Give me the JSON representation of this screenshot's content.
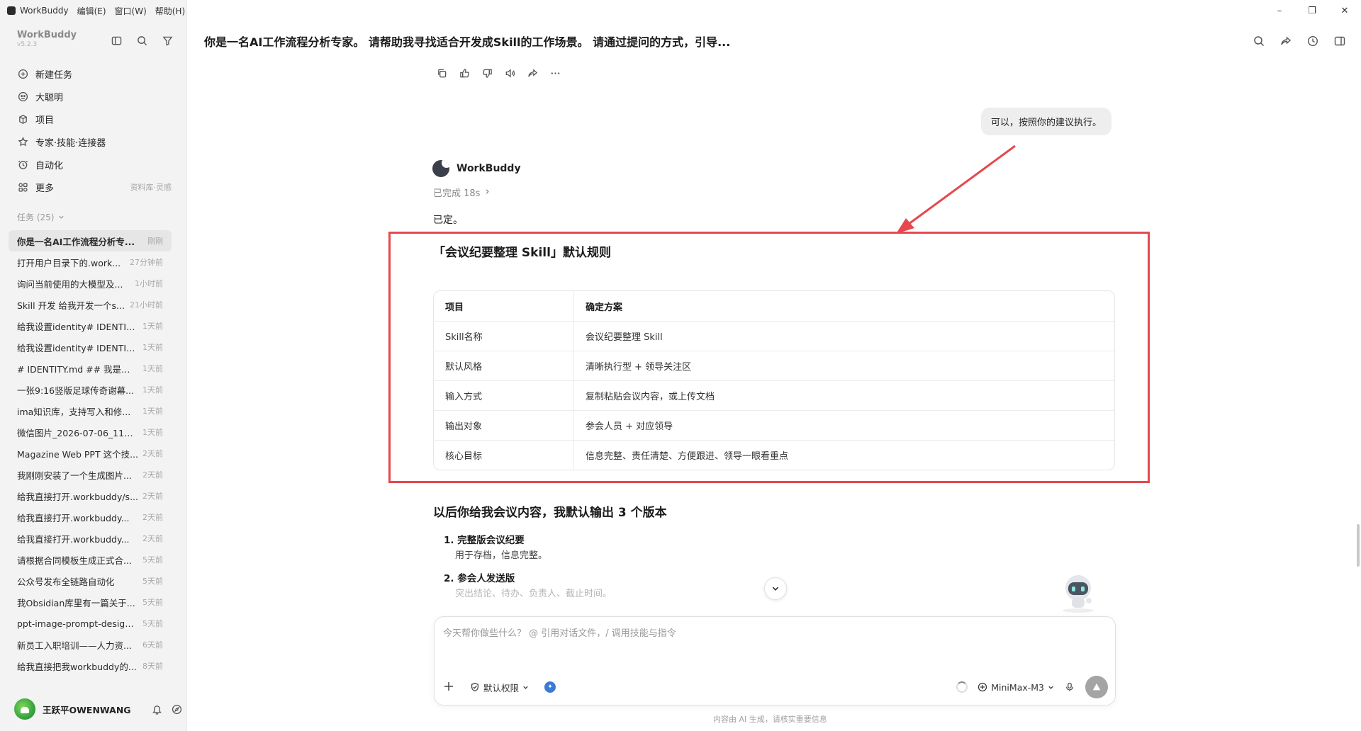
{
  "menubar": {
    "app_name": "WorkBuddy",
    "items": [
      "编辑(E)",
      "窗口(W)",
      "帮助(H)"
    ]
  },
  "brand": {
    "name": "WorkBuddy",
    "version": "v5.2.3"
  },
  "nav": [
    {
      "label": "新建任务",
      "icon": "new-task-icon"
    },
    {
      "label": "大聪明",
      "icon": "assistant-icon"
    },
    {
      "label": "项目",
      "icon": "project-icon"
    },
    {
      "label": "专家·技能·连接器",
      "icon": "expert-icon"
    },
    {
      "label": "自动化",
      "icon": "automation-icon"
    },
    {
      "label": "更多",
      "icon": "more-icon",
      "extra": "资料库·灵感"
    }
  ],
  "tasks": {
    "header": "任务 (25)",
    "items": [
      {
        "title": "你是一名AI工作流程分析专...",
        "time": "刚刚",
        "active": true
      },
      {
        "title": "打开用户目录下的.work...",
        "time": "27分钟前"
      },
      {
        "title": "询问当前使用的大模型及...",
        "time": "1小时前"
      },
      {
        "title": "Skill 开发 给我开发一个s...",
        "time": "21小时前"
      },
      {
        "title": "给我设置identity# IDENTIT...",
        "time": "1天前"
      },
      {
        "title": "给我设置identity# IDENTIT...",
        "time": "1天前"
      },
      {
        "title": "# IDENTITY.md ## 我是谁 ...",
        "time": "1天前"
      },
      {
        "title": "一张9:16竖版足球传奇谢幕...",
        "time": "1天前"
      },
      {
        "title": "ima知识库，支持写入和修...",
        "time": "1天前"
      },
      {
        "title": "微信图片_2026-07-06_1143...",
        "time": "1天前"
      },
      {
        "title": "Magazine Web PPT 这个技...",
        "time": "2天前"
      },
      {
        "title": "我刚刚安装了一个生成图片...",
        "time": "2天前"
      },
      {
        "title": "给我直接打开.workbuddy/s...",
        "time": "2天前"
      },
      {
        "title": "给我直接打开.workbuddy...",
        "time": "2天前"
      },
      {
        "title": "给我直接打开.workbuddy...",
        "time": "2天前"
      },
      {
        "title": "请根据合同模板生成正式合...",
        "time": "5天前"
      },
      {
        "title": "公众号发布全链路自动化",
        "time": "5天前"
      },
      {
        "title": "我Obsidian库里有一篇关于...",
        "time": "5天前"
      },
      {
        "title": "ppt-image-prompt-design...",
        "time": "5天前"
      },
      {
        "title": "新员工入职培训——人力资...",
        "time": "6天前"
      },
      {
        "title": "给我直接把我workbuddy的...",
        "time": "8天前"
      }
    ]
  },
  "user": {
    "name": "王跃平OWENWANG"
  },
  "window": {
    "minimize": "–",
    "maximize": "❐",
    "close": "✕"
  },
  "conversation": {
    "title": "你是一名AI工作流程分析专家。 请帮助我寻找适合开发成Skill的工作场景。 请通过提问的方式，引导...",
    "user_message": "可以，按照你的建议执行。",
    "bot_name": "WorkBuddy",
    "bot_status": "已完成 18s",
    "bot_reply": "已定。",
    "section_title": "「会议纪要整理 Skill」默认规则",
    "table": {
      "headers": [
        "项目",
        "确定方案"
      ],
      "rows": [
        [
          "Skill名称",
          "会议纪要整理 Skill"
        ],
        [
          "默认风格",
          "清晰执行型 + 领导关注区"
        ],
        [
          "输入方式",
          "复制粘贴会议内容，或上传文档"
        ],
        [
          "输出对象",
          "参会人员 + 对应领导"
        ],
        [
          "核心目标",
          "信息完整、责任清楚、方便跟进、领导一眼看重点"
        ]
      ]
    },
    "section2_title": "以后你给我会议内容，我默认输出 3 个版本",
    "versions": [
      {
        "title": "1. 完整版会议纪要",
        "desc": "用于存档，信息完整。"
      },
      {
        "title": "2. 参会人发送版",
        "desc": "突出结论、待办、负责人、截止时间。"
      }
    ]
  },
  "composer": {
    "placeholder": "今天帮你做些什么？ @ 引用对话文件，/ 调用技能与指令",
    "permission": "默认权限",
    "model": "MiniMax-M3"
  },
  "footer_note": "内容由 AI 生成，请核实重要信息",
  "colors": {
    "highlight": "#e5484d",
    "sidebar_bg": "#f3f3f3",
    "accent_blue": "#3a7bd5"
  }
}
